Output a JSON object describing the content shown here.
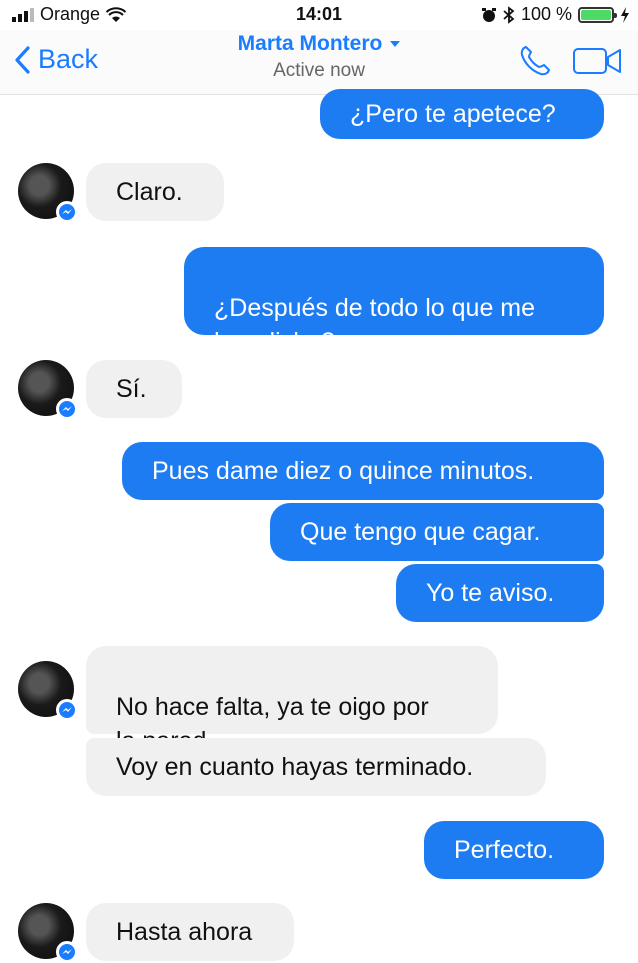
{
  "status_bar": {
    "carrier": "Orange",
    "time": "14:01",
    "battery": "100 %",
    "battery_level": 1.0
  },
  "header": {
    "back_label": "Back",
    "contact_name": "Marta Montero",
    "presence": "Active now",
    "icons": [
      "back-chevron-icon",
      "dropdown-caret-icon",
      "phone-icon",
      "video-camera-icon"
    ]
  },
  "messages": [
    {
      "side": "out",
      "text": "¿Pero te apetece?"
    },
    {
      "side": "in",
      "text": "Claro."
    },
    {
      "side": "out",
      "text": "¿Después de todo lo que me\nhas dicho?"
    },
    {
      "side": "in",
      "text": "Sí."
    },
    {
      "side": "out",
      "text": "Pues dame diez o quince minutos."
    },
    {
      "side": "out",
      "text": "Que tengo que cagar."
    },
    {
      "side": "out",
      "text": "Yo te aviso."
    },
    {
      "side": "in",
      "text": "No hace falta, ya te oigo por\nla pared."
    },
    {
      "side": "in",
      "text": "Voy en cuanto hayas terminado."
    },
    {
      "side": "out",
      "text": "Perfecto."
    },
    {
      "side": "in",
      "text": "Hasta ahora"
    }
  ],
  "colors": {
    "accent": "#1a7cff",
    "outgoing_bubble": "#1d7cf2",
    "incoming_bubble": "#f1f0f0",
    "battery_fill": "#4cd964"
  }
}
